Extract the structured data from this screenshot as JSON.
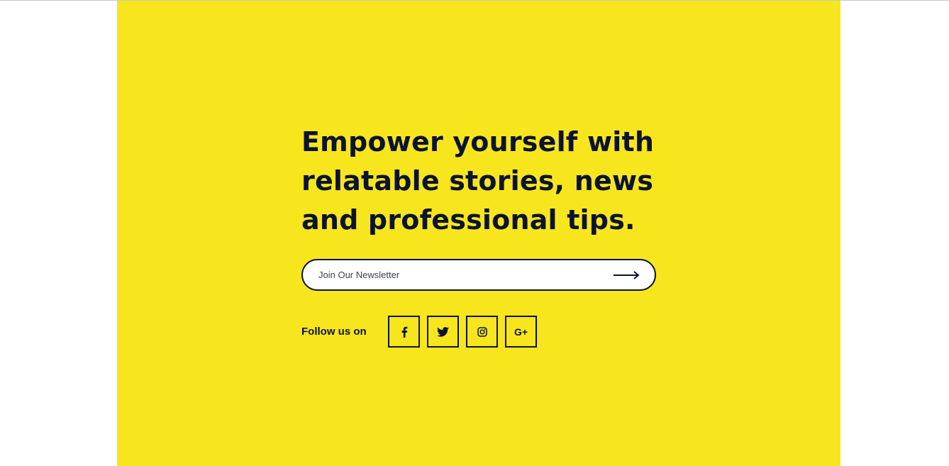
{
  "headline": {
    "line1": "Empower yourself with",
    "line2": "relatable stories, news",
    "line3": "and professional tips."
  },
  "newsletter": {
    "placeholder": "Join Our Newsletter",
    "value": "",
    "submit_icon": "arrow-right-icon"
  },
  "social": {
    "label": "Follow us on",
    "items": [
      {
        "name": "facebook",
        "icon": "facebook-icon"
      },
      {
        "name": "twitter",
        "icon": "twitter-icon"
      },
      {
        "name": "instagram",
        "icon": "instagram-icon"
      },
      {
        "name": "google-plus",
        "icon": "google-plus-icon",
        "glyph": "G+"
      }
    ]
  },
  "colors": {
    "panel": "#f7e61e",
    "text": "#0b1330",
    "background": "#ffffff"
  }
}
